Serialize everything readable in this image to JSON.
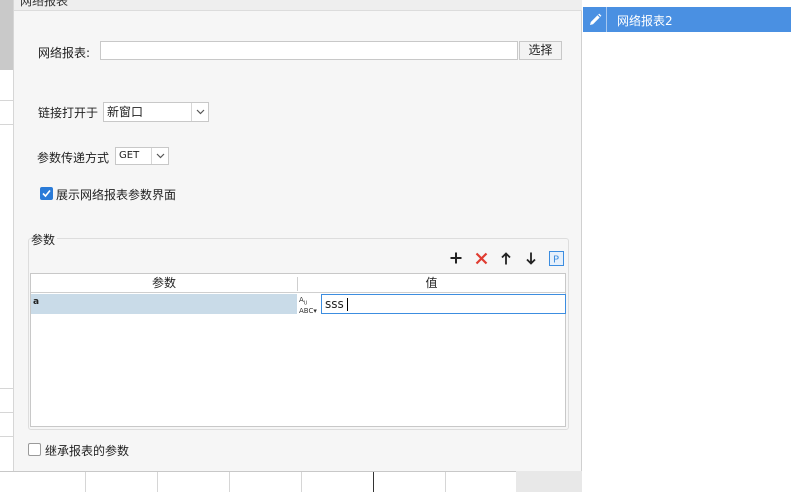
{
  "dialog": {
    "title": "网络报表"
  },
  "form": {
    "report_label": "网络报表:",
    "report_value": "",
    "choose_button": "选择",
    "open_label": "链接打开于",
    "open_value": "新窗口",
    "method_label": "参数传递方式",
    "method_value": "GET",
    "show_params_label": "展示网络报表参数界面",
    "show_params_checked": true
  },
  "params": {
    "group_title": "参数",
    "toolbar": {
      "add_icon": "plus-icon",
      "delete_icon": "red-x-icon",
      "up_icon": "arrow-up-icon",
      "down_icon": "arrow-down-icon",
      "param_icon": "p-icon"
    },
    "columns": [
      "参数",
      "值"
    ],
    "rows": [
      {
        "name": "a",
        "type_icon": "abc-type-icon",
        "value": "sss"
      }
    ]
  },
  "inherit": {
    "label": "继承报表的参数",
    "checked": false
  },
  "right_panel": {
    "items": [
      {
        "label": "网络报表2",
        "icon": "pencil-icon",
        "selected": true
      }
    ]
  },
  "colors": {
    "accent": "#4a90e2",
    "checkbox": "#2a7bd8",
    "delete": "#e03c31",
    "row_selected": "#c9dbe8"
  }
}
